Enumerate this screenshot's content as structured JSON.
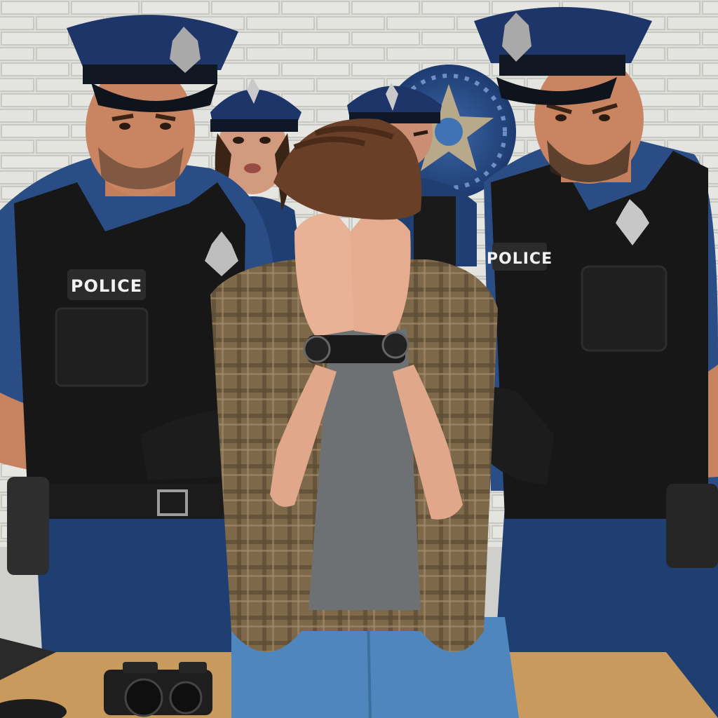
{
  "scene": {
    "description_free": true,
    "officer_left": {
      "vest_patch": "POLICE"
    },
    "officer_right": {
      "vest_patch": "POLICE"
    }
  },
  "colors": {
    "uniform_blue": "#1f3f73",
    "vest_black": "#161616",
    "wall_white": "#dcdcd8",
    "table_wood": "#c89a5e",
    "jeans_blue": "#4f86bd",
    "shirt_plaid": "#7a6548",
    "skin": "#d89a7b",
    "hair_brown": "#6a3f27",
    "badge_silver": "#c9c9c9"
  }
}
